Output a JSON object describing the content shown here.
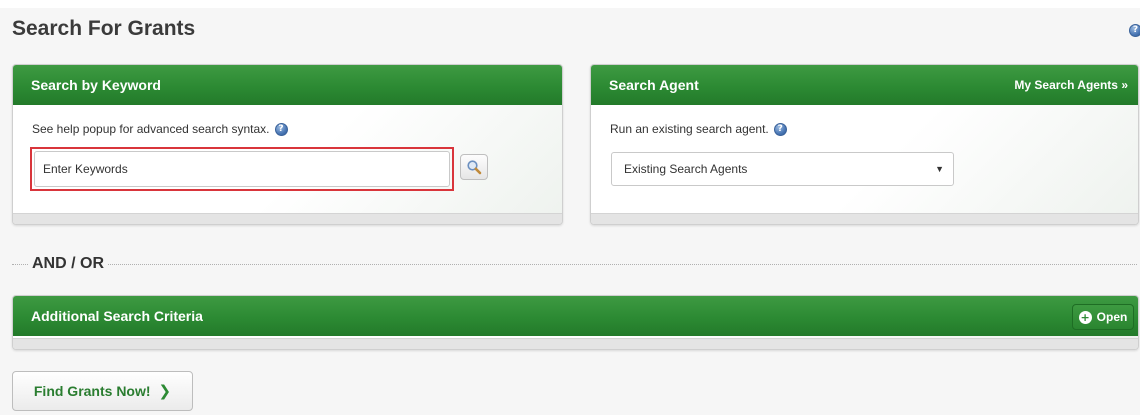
{
  "page": {
    "title": "Search For Grants",
    "help_glyph": "?"
  },
  "keyword": {
    "header": "Search by Keyword",
    "help_text": "See help popup for advanced search syntax.",
    "input_placeholder": "Enter Keywords",
    "input_value": "",
    "search_icon": "magnifier-icon"
  },
  "agent": {
    "header": "Search Agent",
    "link_label": "My Search Agents »",
    "help_text": "Run an existing search agent.",
    "select_value": "Existing Search Agents",
    "caret_glyph": "▼"
  },
  "separator": {
    "label": "AND / OR"
  },
  "criteria": {
    "header": "Additional Search Criteria",
    "open_label": "Open",
    "plus_glyph": "+"
  },
  "actions": {
    "find_label": "Find Grants Now!",
    "find_glyph": "❯"
  },
  "colors": {
    "header_green": "#2c8a33",
    "highlight_red": "#d9353b",
    "help_blue": "#4a77b5"
  }
}
